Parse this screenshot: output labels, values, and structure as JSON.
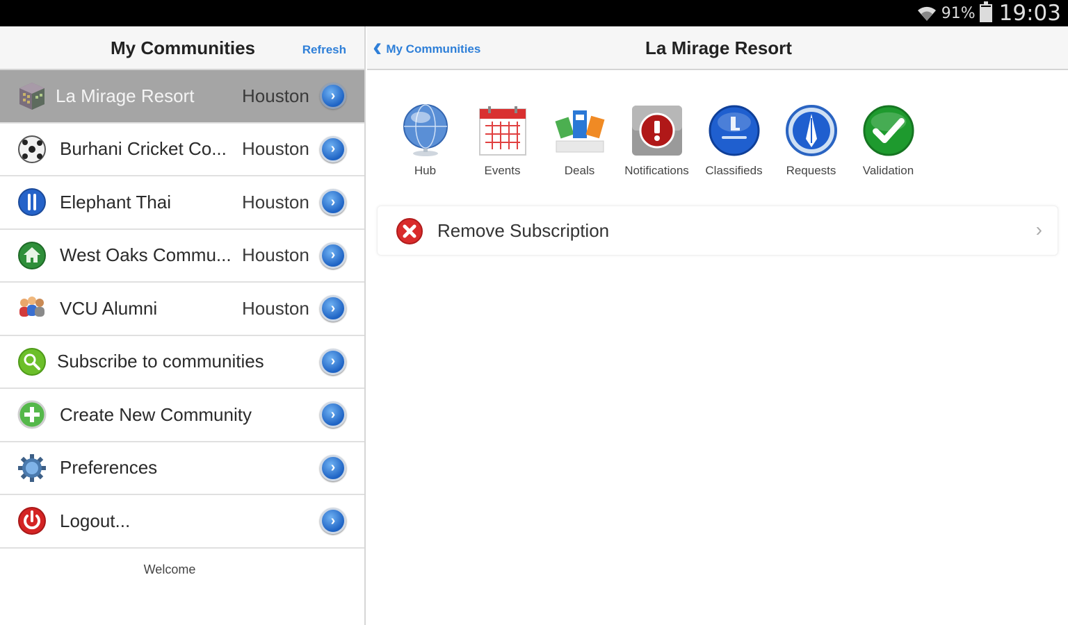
{
  "status_bar": {
    "battery_percent": "91%",
    "battery_level": 0.91,
    "time": "19:03"
  },
  "left": {
    "title": "My Communities",
    "refresh_label": "Refresh",
    "items": [
      {
        "name": "La Mirage Resort",
        "city": "Houston",
        "icon": "building-icon",
        "selected": true
      },
      {
        "name": "Burhani Cricket Co...",
        "city": "Houston",
        "icon": "cricket-ball-icon"
      },
      {
        "name": "Elephant Thai",
        "city": "Houston",
        "icon": "restaurant-icon"
      },
      {
        "name": "West Oaks Commu...",
        "city": "Houston",
        "icon": "home-community-icon"
      },
      {
        "name": "VCU Alumni",
        "city": "Houston",
        "icon": "people-icon"
      },
      {
        "name": "Subscribe to communities",
        "city": "",
        "icon": "search-icon"
      },
      {
        "name": "Create New Community",
        "city": "",
        "icon": "add-icon"
      },
      {
        "name": "Preferences",
        "city": "",
        "icon": "gear-icon"
      },
      {
        "name": "Logout...",
        "city": "",
        "icon": "power-icon"
      }
    ],
    "welcome": "Welcome"
  },
  "right": {
    "back_label": "My Communities",
    "title": "La Mirage Resort",
    "tools": [
      {
        "label": "Hub",
        "icon": "globe-icon"
      },
      {
        "label": "Events",
        "icon": "calendar-icon"
      },
      {
        "label": "Deals",
        "icon": "deals-icon"
      },
      {
        "label": "Notifications",
        "icon": "alert-icon"
      },
      {
        "label": "Classifieds",
        "icon": "classifieds-icon"
      },
      {
        "label": "Requests",
        "icon": "requests-icon"
      },
      {
        "label": "Validation",
        "icon": "checkmark-icon"
      }
    ],
    "remove_label": "Remove Subscription"
  },
  "colors": {
    "accent": "#2e7fd8",
    "selected_row": "#a5a5a5",
    "status_bar": "#000000"
  }
}
